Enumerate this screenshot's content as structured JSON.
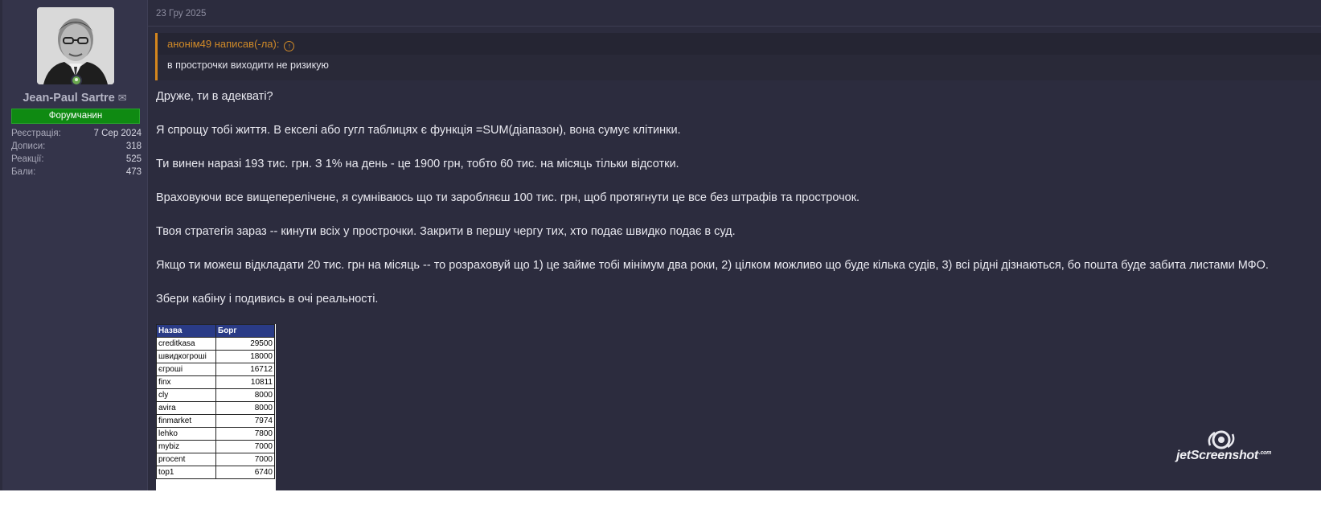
{
  "user": {
    "name": "Jean-Paul Sartre",
    "banner": "Форумчанин",
    "stats": [
      {
        "label": "Реєстрація:",
        "value": "7 Сер 2024"
      },
      {
        "label": "Дописи:",
        "value": "318"
      },
      {
        "label": "Реакції:",
        "value": "525"
      },
      {
        "label": "Бали:",
        "value": "473"
      }
    ]
  },
  "post": {
    "date": "23 Гру 2025",
    "quote": {
      "author": "анонім49 написав(-ла):",
      "text": "в прострочки виходити не ризикую"
    },
    "paragraphs": [
      "Друже, ти в адекваті?",
      "Я спрощу тобі життя. В екселі або гугл таблицях є функція =SUM(діапазон), вона сумує клітинки.",
      "Ти винен наразі 193 тис. грн. З 1% на день - це 1900 грн, тобто 60 тис. на місяць тільки відсотки.",
      "Враховуючи все вищеперелічене, я сумніваюсь що ти заробляєш 100 тис. грн, щоб протягнути це все без штрафів та прострочок.",
      "Твоя стратегія зараз -- кинути всіх у прострочки. Закрити в першу чергу тих, хто подає швидко подає в суд.",
      "Якщо ти можеш відкладати 20 тис. грн на місяць -- то розраховуй що 1) це займе тобі мінімум два роки, 2) цілком можливо що буде кілька судів, 3) всі рідні дізнаються, бо пошта буде забита листами МФО.",
      "Збери кабіну і подивись в очі реальності."
    ],
    "table": {
      "headers": [
        "Назва",
        "Борг"
      ],
      "rows": [
        [
          "creditkasa",
          "29500"
        ],
        [
          "швидкогроші",
          "18000"
        ],
        [
          "єгроші",
          "16712"
        ],
        [
          "finx",
          "10811"
        ],
        [
          "cly",
          "8000"
        ],
        [
          "avira",
          "8000"
        ],
        [
          "finmarket",
          "7974"
        ],
        [
          "lehko",
          "7800"
        ],
        [
          "mybiz",
          "7000"
        ],
        [
          "procent",
          "7000"
        ],
        [
          "top1",
          "6740"
        ]
      ]
    }
  },
  "watermark": {
    "text": "jetScreenshot",
    "suffix": ".com"
  },
  "colors": {
    "accent": "#d08a28",
    "banner": "#0f8a12",
    "background": "#2c2c3e"
  }
}
